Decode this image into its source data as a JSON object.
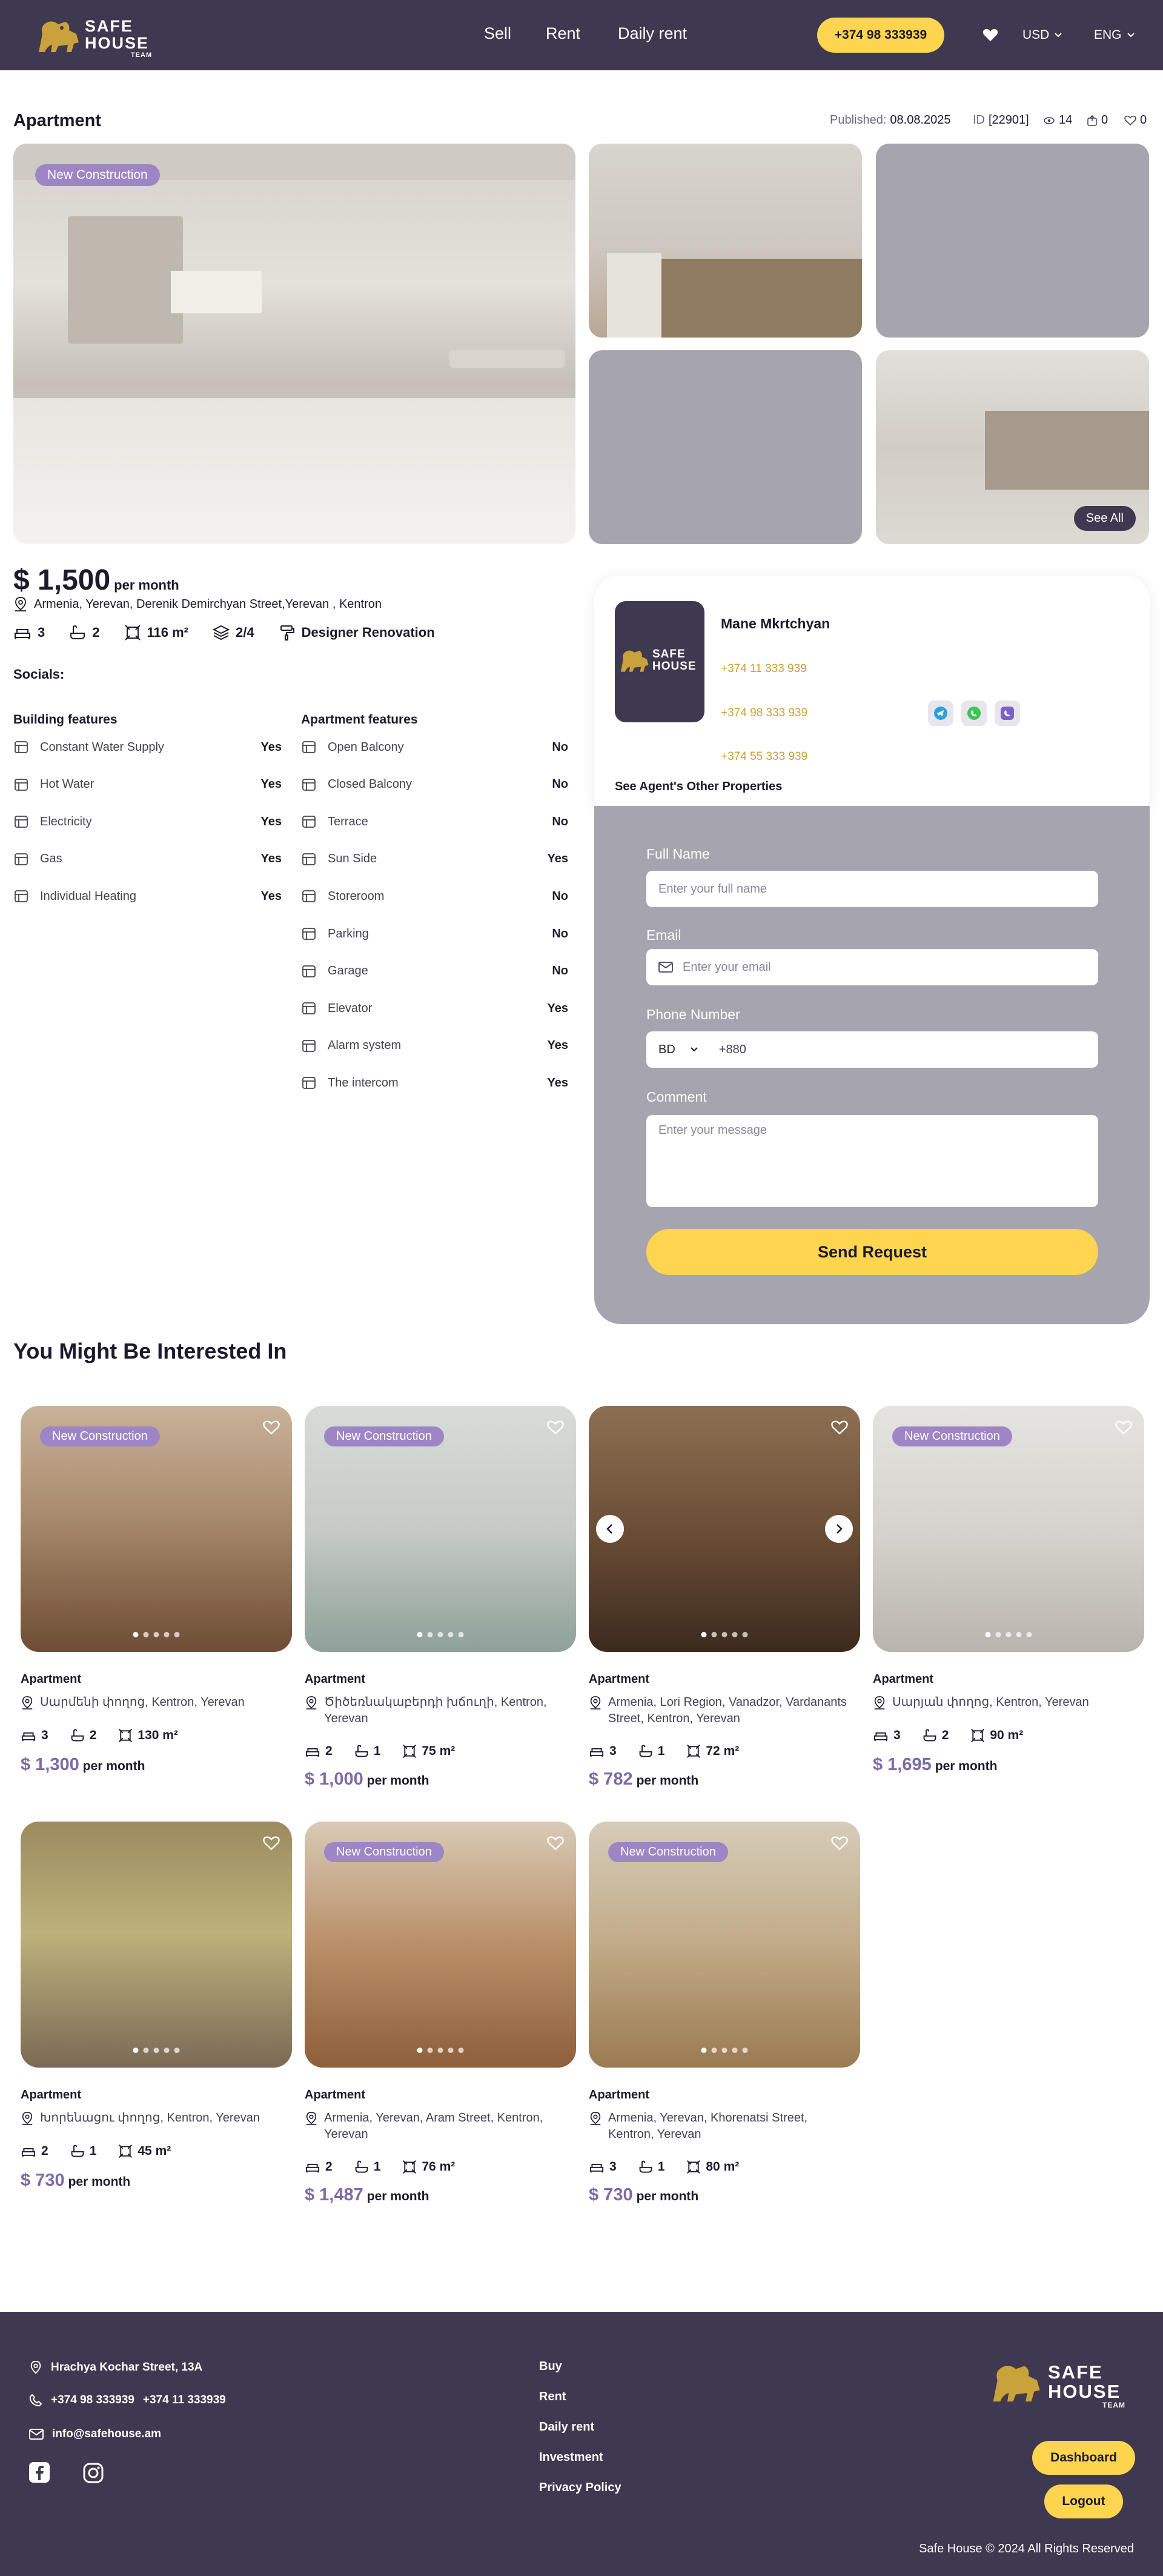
{
  "brand": {
    "name_line1": "SAFE",
    "name_line2": "HOUSE",
    "name_line3": "TEAM",
    "primary": "#3e3850",
    "accent": "#fed54e",
    "badge": "#9d85c6",
    "gold": "#c9a23a"
  },
  "header": {
    "nav": [
      "Sell",
      "Rent",
      "Daily rent"
    ],
    "phone": "+374 98 333939",
    "currency": "USD",
    "language": "ENG"
  },
  "listing": {
    "title": "Apartment",
    "published_label": "Published:",
    "published": "08.08.2025",
    "id_label": "ID",
    "id": "[22901]",
    "views": "14",
    "shares": "0",
    "likes": "0",
    "badge": "New Construction",
    "see_all": "See All",
    "price": "$ 1,500",
    "price_unit": "per month",
    "address": "Armenia, Yerevan, Derenik Demirchyan Street,Yerevan , Kentron",
    "rooms": "3",
    "baths": "2",
    "area": "116 m²",
    "floor": "2/4",
    "renovation": "Designer Renovation",
    "socials_label": "Socials:"
  },
  "building_features": {
    "title": "Building features",
    "items": [
      {
        "name": "Constant Water Supply",
        "value": "Yes",
        "icon": "water-tap-icon"
      },
      {
        "name": "Hot Water",
        "value": "Yes",
        "icon": "hot-water-icon"
      },
      {
        "name": "Electricity",
        "value": "Yes",
        "icon": "electricity-icon"
      },
      {
        "name": "Gas",
        "value": "Yes",
        "icon": "gas-icon"
      },
      {
        "name": "Individual Heating",
        "value": "Yes",
        "icon": "heating-icon"
      }
    ]
  },
  "apartment_features": {
    "title": "Apartment features",
    "items": [
      {
        "name": "Open Balcony",
        "value": "No",
        "icon": "balcony-icon"
      },
      {
        "name": "Closed Balcony",
        "value": "No",
        "icon": "closed-balcony-icon"
      },
      {
        "name": "Terrace",
        "value": "No",
        "icon": "terrace-icon"
      },
      {
        "name": "Sun Side",
        "value": "Yes",
        "icon": "sun-icon"
      },
      {
        "name": "Storeroom",
        "value": "No",
        "icon": "storeroom-icon"
      },
      {
        "name": "Parking",
        "value": "No",
        "icon": "parking-icon"
      },
      {
        "name": "Garage",
        "value": "No",
        "icon": "garage-icon"
      },
      {
        "name": "Elevator",
        "value": "Yes",
        "icon": "elevator-icon"
      },
      {
        "name": "Alarm system",
        "value": "Yes",
        "icon": "alarm-icon"
      },
      {
        "name": "The intercom",
        "value": "Yes",
        "icon": "intercom-icon"
      }
    ]
  },
  "agent": {
    "name": "Mane Mkrtchyan",
    "phones": [
      "+374 11 333 939",
      "+374 98 333 939",
      "+374 55 333 939"
    ],
    "other_properties": "See Agent's Other Properties"
  },
  "form": {
    "full_name_label": "Full Name",
    "full_name_placeholder": "Enter your full name",
    "email_label": "Email",
    "email_placeholder": "Enter your email",
    "phone_label": "Phone Number",
    "country": "BD",
    "phone_prefix": "+880",
    "comment_label": "Comment",
    "comment_placeholder": "Enter your message",
    "submit": "Send Request"
  },
  "related": {
    "title": "You Might Be Interested In",
    "badge": "New Construction",
    "cards": [
      {
        "type": "Apartment",
        "address": "Սարմենի փողոց, Kentron, Yerevan",
        "rooms": "3",
        "baths": "2",
        "area": "130 m²",
        "price": "$ 1,300",
        "unit": "per month",
        "badge": true
      },
      {
        "type": "Apartment",
        "address": "Ծիծեռնակաբերդի խճուղի, Kentron, Yerevan",
        "rooms": "2",
        "baths": "1",
        "area": "75 m²",
        "price": "$ 1,000",
        "unit": "per month",
        "badge": true
      },
      {
        "type": "Apartment",
        "address": "Armenia, Lori Region, Vanadzor, Vardanants Street, Kentron, Yerevan",
        "rooms": "3",
        "baths": "1",
        "area": "72 m²",
        "price": "$ 782",
        "unit": "per month",
        "badge": false
      },
      {
        "type": "Apartment",
        "address": "Սարյան փողոց, Kentron, Yerevan",
        "rooms": "3",
        "baths": "2",
        "area": "90 m²",
        "price": "$ 1,695",
        "unit": "per month",
        "badge": true
      },
      {
        "type": "Apartment",
        "address": "Խորենացու փողոց, Kentron, Yerevan",
        "rooms": "2",
        "baths": "1",
        "area": "45 m²",
        "price": "$ 730",
        "unit": "per month",
        "badge": false
      },
      {
        "type": "Apartment",
        "address": "Armenia, Yerevan, Aram Street, Kentron, Yerevan",
        "rooms": "2",
        "baths": "1",
        "area": "76 m²",
        "price": "$ 1,487",
        "unit": "per month",
        "badge": true
      },
      {
        "type": "Apartment",
        "address": "Armenia, Yerevan, Khorenatsi Street, Kentron, Yerevan",
        "rooms": "3",
        "baths": "1",
        "area": "80 m²",
        "price": "$ 730",
        "unit": "per month",
        "badge": true
      }
    ]
  },
  "footer": {
    "address": "Hrachya Kochar Street, 13A",
    "phone1": "+374 98 333939",
    "phone2": "+374 11 333939",
    "email": "info@safehouse.am",
    "links": [
      "Buy",
      "Rent",
      "Daily rent",
      "Investment",
      "Privacy Policy"
    ],
    "dashboard": "Dashboard",
    "logout": "Logout",
    "copyright": "Safe House © 2024 All Rights Reserved"
  }
}
